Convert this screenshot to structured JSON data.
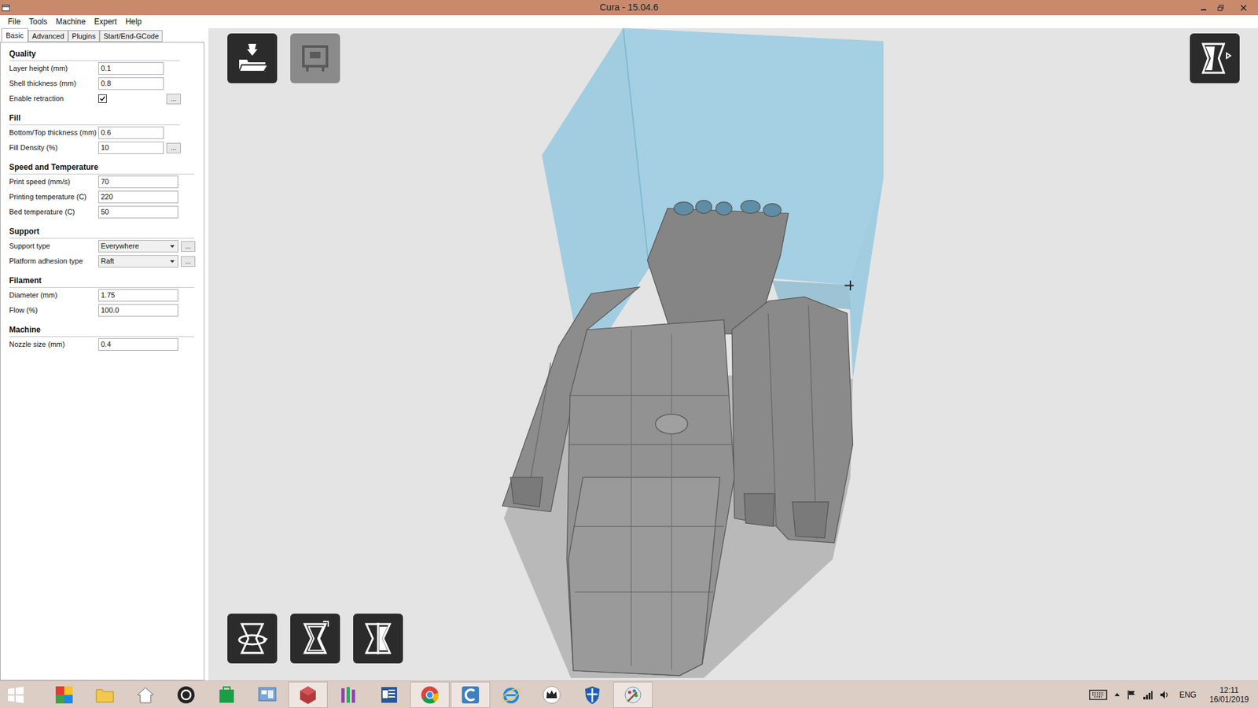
{
  "window": {
    "title": "Cura - 15.04.6"
  },
  "menu": [
    "File",
    "Tools",
    "Machine",
    "Expert",
    "Help"
  ],
  "tabs": [
    {
      "label": "Basic",
      "selected": true
    },
    {
      "label": "Advanced",
      "selected": false
    },
    {
      "label": "Plugins",
      "selected": false
    },
    {
      "label": "Start/End-GCode",
      "selected": false
    }
  ],
  "sections": [
    {
      "title": "Quality",
      "rows": [
        {
          "label": "Layer height (mm)",
          "kind": "text",
          "value": "0.1"
        },
        {
          "label": "Shell thickness (mm)",
          "kind": "text",
          "value": "0.8"
        },
        {
          "label": "Enable retraction",
          "kind": "checkbox",
          "checked": true,
          "button": "..."
        }
      ]
    },
    {
      "title": "Fill",
      "rows": [
        {
          "label": "Bottom/Top thickness (mm)",
          "kind": "text",
          "value": "0.6"
        },
        {
          "label": "Fill Density (%)",
          "kind": "text",
          "value": "10",
          "button": "..."
        }
      ]
    },
    {
      "title": "Speed and Temperature",
      "rows": [
        {
          "label": "Print speed (mm/s)",
          "kind": "text",
          "value": "70"
        },
        {
          "label": "Printing temperature (C)",
          "kind": "text",
          "value": "220"
        },
        {
          "label": "Bed temperature (C)",
          "kind": "text",
          "value": "50"
        }
      ]
    },
    {
      "title": "Support",
      "rows": [
        {
          "label": "Support type",
          "kind": "select",
          "value": "Everywhere",
          "button": "..."
        },
        {
          "label": "Platform adhesion type",
          "kind": "select",
          "value": "Raft",
          "button": "..."
        }
      ]
    },
    {
      "title": "Filament",
      "rows": [
        {
          "label": "Diameter (mm)",
          "kind": "text",
          "value": "1.75"
        },
        {
          "label": "Flow (%)",
          "kind": "text",
          "value": "100.0"
        }
      ]
    },
    {
      "title": "Machine",
      "rows": [
        {
          "label": "Nozzle size (mm)",
          "kind": "text",
          "value": "0.4"
        }
      ]
    }
  ],
  "viewport": {
    "top_left_buttons": [
      {
        "disabled": false
      },
      {
        "disabled": true
      }
    ],
    "top_right_buttons": [
      {
        "disabled": false
      }
    ],
    "bottom_buttons": [
      {
        "disabled": false
      },
      {
        "disabled": false
      },
      {
        "disabled": false
      }
    ]
  },
  "taskbar": {
    "apps": [
      {
        "active": false
      },
      {
        "active": false
      },
      {
        "active": false
      },
      {
        "active": false
      },
      {
        "active": false
      },
      {
        "active": false
      },
      {
        "active": true
      },
      {
        "active": false
      },
      {
        "active": false
      },
      {
        "active": true
      },
      {
        "active": true
      },
      {
        "active": false
      },
      {
        "active": false
      },
      {
        "active": false
      },
      {
        "active": true
      }
    ],
    "language": "ENG",
    "time": "12:11",
    "date": "16/01/2019"
  }
}
